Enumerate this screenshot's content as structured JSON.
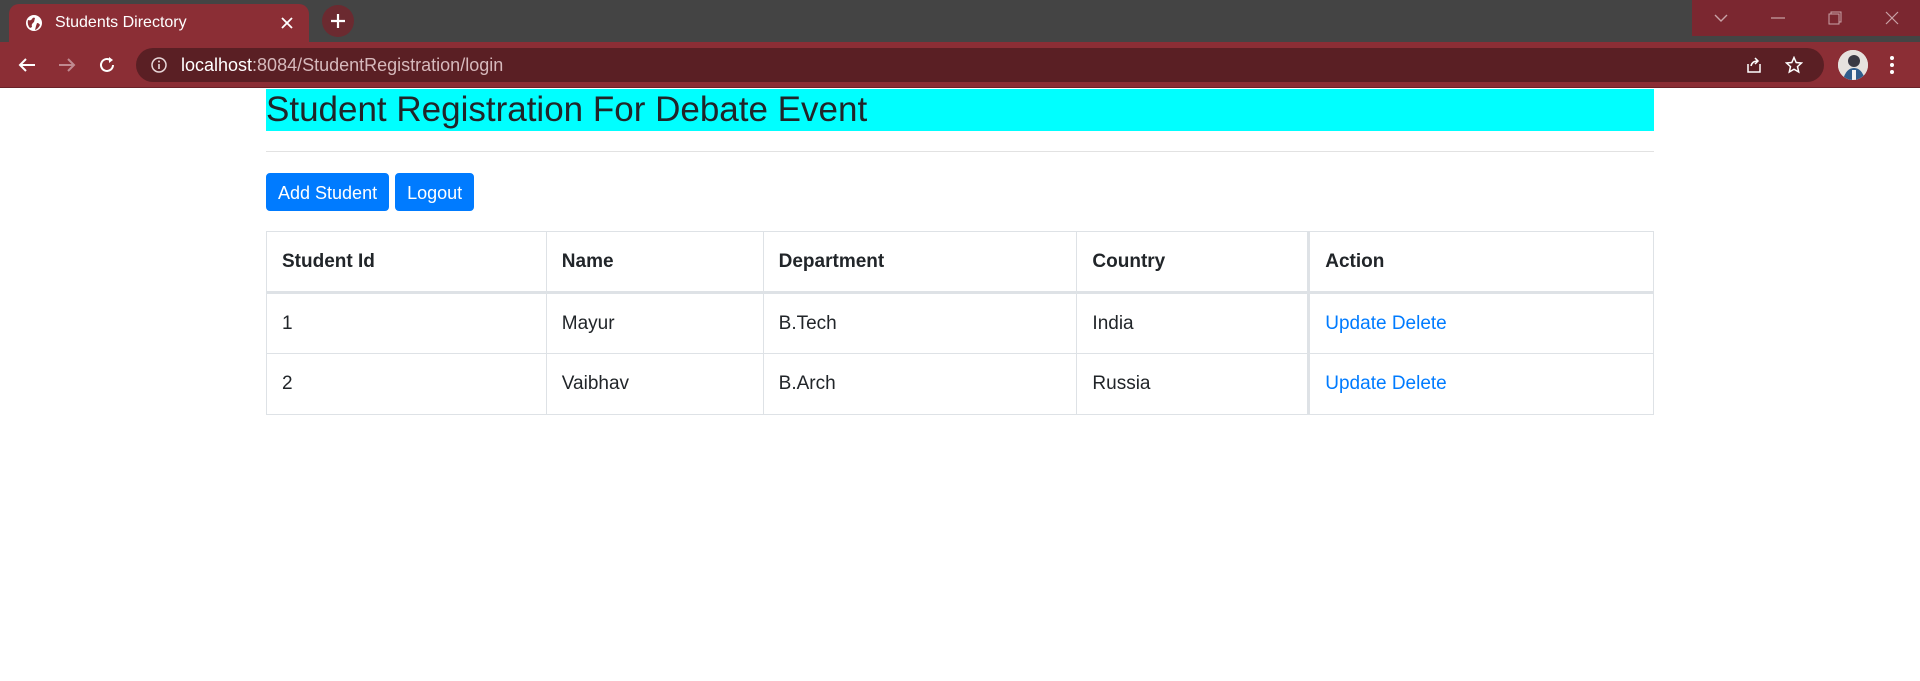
{
  "browser": {
    "tab_title": "Students Directory",
    "url_host": "localhost",
    "url_path": ":8084/StudentRegistration/login"
  },
  "page": {
    "heading": "Student Registration For Debate Event",
    "buttons": {
      "add_student": "Add Student",
      "logout": "Logout"
    },
    "table": {
      "headers": [
        "Student Id",
        "Name",
        "Department",
        "Country",
        "Action"
      ],
      "rows": [
        {
          "id": "1",
          "name": "Mayur",
          "department": "B.Tech",
          "country": "India",
          "update": "Update",
          "delete": "Delete"
        },
        {
          "id": "2",
          "name": "Vaibhav",
          "department": "B.Arch",
          "country": "Russia",
          "update": "Update",
          "delete": "Delete"
        }
      ]
    }
  },
  "colors": {
    "chrome_accent": "#8b2e35",
    "heading_bg": "#00ffff",
    "primary": "#007bff"
  }
}
